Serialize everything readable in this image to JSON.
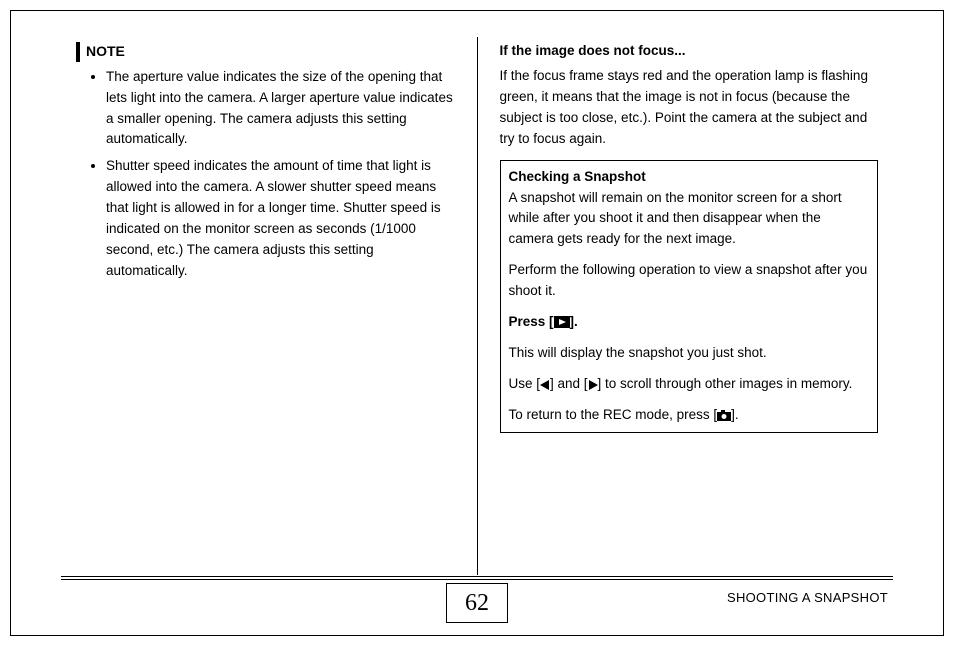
{
  "note": {
    "label": "NOTE",
    "bullets": [
      "The aperture value indicates the size of the opening that lets light into the camera. A larger aperture value indicates a smaller opening. The camera adjusts this setting automatically.",
      "Shutter speed indicates the amount of time that light is allowed into the camera. A slower shutter speed means that light is allowed in for a longer time. Shutter speed is indicated on the monitor screen as seconds (1/1000 second, etc.) The camera adjusts this setting automatically."
    ]
  },
  "right": {
    "heading": "If the image does not focus...",
    "paragraph": "If the focus frame stays red and the operation lamp is flashing green, it means that the image is not in focus (because the subject is too close, etc.). Point the camera at the subject and try to focus again.",
    "box": {
      "title": "Checking a Snapshot",
      "p1": "A snapshot will remain on the monitor screen for a short while after you shoot it and then disappear when the camera gets ready for the next image.",
      "p2": "Perform the following operation to view a snapshot after you shoot it.",
      "press_label_pre": "Press [",
      "press_label_post": "].",
      "p3": "This will display the snapshot you just shot.",
      "p4_pre": "Use [",
      "p4_mid": "] and [",
      "p4_post": "] to scroll through other images in memory.",
      "p5_pre": "To return to the REC mode, press [",
      "p5_post": "]."
    }
  },
  "footer": {
    "page_number": "62",
    "section": "SHOOTING A SNAPSHOT"
  }
}
